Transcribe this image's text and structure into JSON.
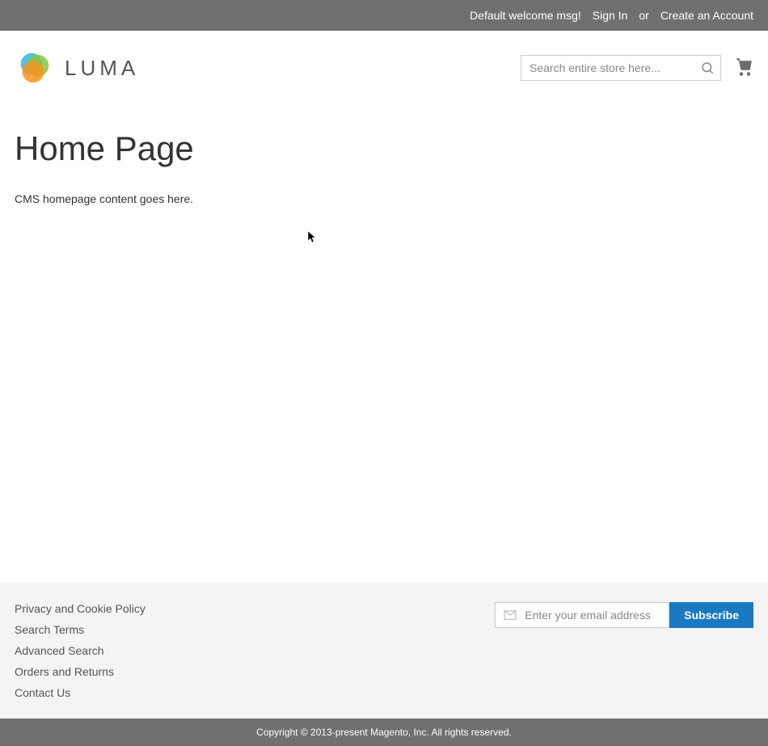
{
  "topbar": {
    "welcome": "Default welcome msg!",
    "signin": "Sign In",
    "or": "or",
    "create": "Create an Account"
  },
  "header": {
    "logo_text": "LUMA",
    "search_placeholder": "Search entire store here..."
  },
  "main": {
    "title": "Home Page",
    "content": "CMS homepage content goes here."
  },
  "footer": {
    "links": {
      "privacy": "Privacy and Cookie Policy",
      "search_terms": "Search Terms",
      "advanced_search": "Advanced Search",
      "orders_returns": "Orders and Returns",
      "contact": "Contact Us"
    },
    "email_placeholder": "Enter your email address",
    "subscribe": "Subscribe"
  },
  "copyright": "Copyright © 2013-present Magento, Inc. All rights reserved."
}
